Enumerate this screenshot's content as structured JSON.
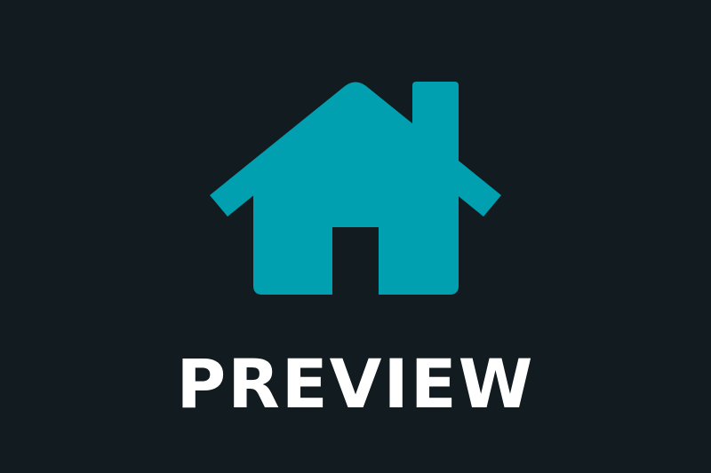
{
  "label": "PREVIEW",
  "icon": {
    "name": "home-icon",
    "color": "#00a0b0"
  },
  "colors": {
    "background": "#121b1f",
    "text": "#ffffff"
  }
}
